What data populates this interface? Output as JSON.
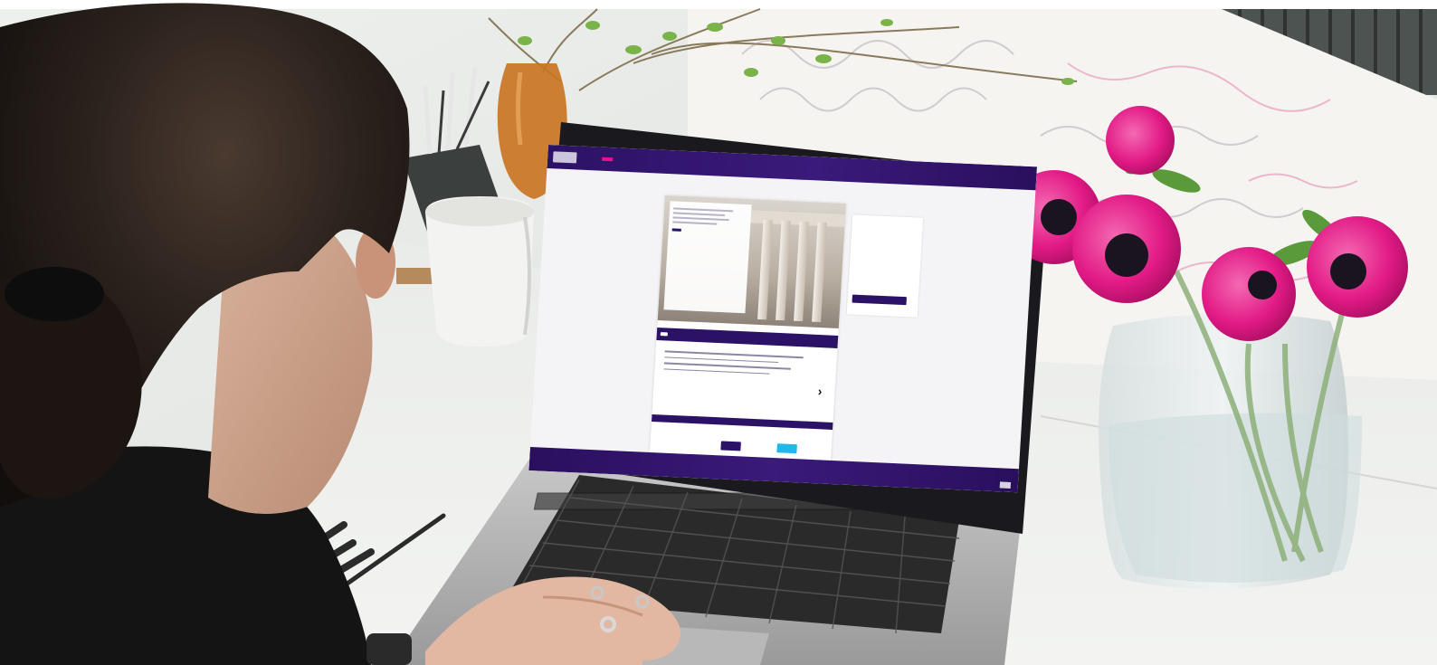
{
  "scene": {
    "description_tag": "photo-scene",
    "colors": {
      "brand_navy": "#2c1266",
      "brand_magenta": "#e6148c",
      "accent_cyan": "#1fb8e8",
      "flower_pink": "#e21a86"
    }
  },
  "screen": {
    "nav": {
      "items": [
        "",
        "",
        ""
      ]
    },
    "hero": {
      "title": ""
    },
    "tabs": [
      "",
      "",
      ""
    ],
    "panel": {
      "title": ""
    }
  }
}
